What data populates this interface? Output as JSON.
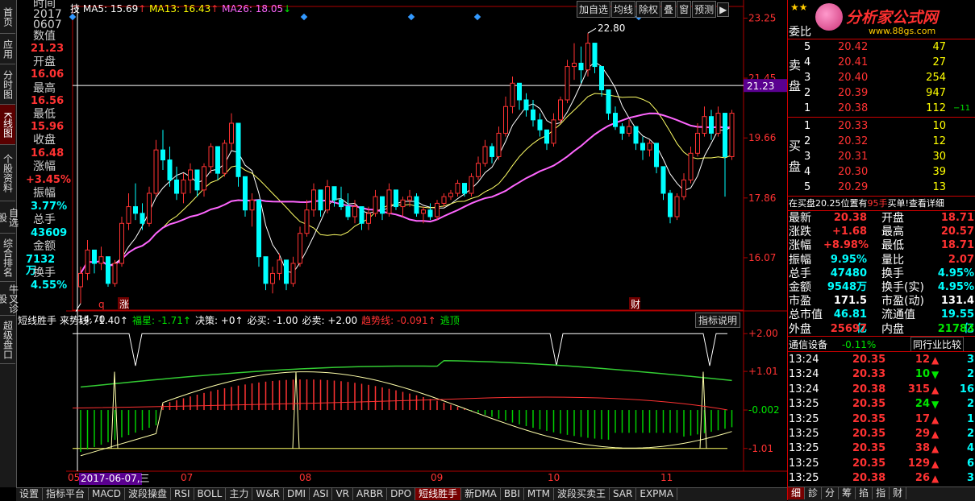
{
  "nav": [
    "首页",
    "应用",
    "分时图",
    "K线图",
    "个股资料",
    "自选股",
    "综合排名",
    "牛叉诊股",
    "超级盘口"
  ],
  "nav_active": 3,
  "info": {
    "time_label": "时间",
    "year": "2017",
    "date": "0607",
    "value_label": "数值",
    "value": "21.23",
    "open_label": "开盘",
    "open": "16.06",
    "high_label": "最高",
    "high": "16.56",
    "low_label": "最低",
    "low": "15.96",
    "close_label": "收盘",
    "close": "16.48",
    "chg_label": "涨幅",
    "chg": "+3.45%",
    "amp_label": "振幅",
    "amp": "3.77%",
    "vol_label": "总手",
    "vol": "43609",
    "amt_label": "金额",
    "amt": "7132万",
    "turn_label": "换手",
    "turn": "4.55%"
  },
  "ma_line": {
    "prefix": "技",
    "ma5": "MA5: 15.69",
    "ma13": "MA13: 16.43",
    "ma26": "MA26: 18.05"
  },
  "toolbar": [
    "加自选",
    "均线",
    "除权",
    "叠",
    "窗",
    "预测",
    "▶"
  ],
  "chart_data": {
    "type": "candlestick",
    "y_ticks": [
      "23.25",
      "21.45",
      "19.66",
      "17.86",
      "16.07"
    ],
    "y_ticks_values": [
      23.25,
      21.45,
      19.66,
      17.86,
      16.07
    ],
    "ylim": [
      14.5,
      23.6
    ],
    "crosshair_value": "21.23",
    "crosshair": 21.23,
    "max_label": "22.80",
    "min_label": "14.70",
    "x_labels": [
      "05",
      "07",
      "08",
      "09",
      "10",
      "11"
    ],
    "cursor_date": "2017-06-07,三",
    "markers": [
      "q",
      "涨",
      "财"
    ],
    "candles": [
      [
        15.2,
        15.8,
        14.7,
        15.6
      ],
      [
        15.6,
        16.6,
        15.4,
        16.3
      ],
      [
        16.3,
        16.2,
        15.6,
        15.9
      ],
      [
        15.9,
        16.4,
        15.7,
        16.1
      ],
      [
        16.1,
        15.5,
        15.2,
        15.3
      ],
      [
        15.3,
        16.0,
        15.2,
        15.9
      ],
      [
        15.9,
        17.3,
        15.8,
        17.1
      ],
      [
        17.1,
        18.0,
        16.9,
        17.6
      ],
      [
        17.6,
        18.3,
        17.2,
        17.4
      ],
      [
        17.4,
        17.7,
        16.9,
        17.1
      ],
      [
        17.1,
        18.2,
        17.0,
        18.0
      ],
      [
        18.0,
        19.6,
        17.9,
        19.3
      ],
      [
        19.3,
        19.9,
        18.7,
        19.0
      ],
      [
        19.0,
        19.4,
        18.2,
        18.4
      ],
      [
        18.4,
        18.8,
        17.8,
        18.0
      ],
      [
        18.0,
        18.6,
        17.7,
        18.4
      ],
      [
        18.4,
        18.9,
        18.0,
        18.7
      ],
      [
        18.7,
        18.6,
        17.9,
        18.1
      ],
      [
        18.1,
        18.9,
        17.9,
        18.8
      ],
      [
        18.8,
        19.5,
        18.6,
        19.4
      ],
      [
        19.4,
        19.3,
        18.4,
        18.6
      ],
      [
        18.6,
        19.6,
        18.5,
        19.5
      ],
      [
        19.5,
        20.4,
        19.3,
        20.1
      ],
      [
        20.1,
        19.8,
        18.2,
        18.5
      ],
      [
        18.5,
        18.2,
        17.3,
        17.5
      ],
      [
        17.5,
        18.0,
        17.0,
        17.8
      ],
      [
        17.8,
        17.6,
        15.8,
        16.1
      ],
      [
        16.1,
        15.9,
        15.1,
        15.3
      ],
      [
        15.3,
        15.8,
        15.0,
        15.6
      ],
      [
        15.6,
        16.2,
        15.4,
        16.0
      ],
      [
        16.0,
        15.8,
        15.1,
        15.3
      ],
      [
        15.3,
        16.1,
        15.2,
        15.9
      ],
      [
        15.9,
        17.0,
        15.8,
        16.8
      ],
      [
        16.8,
        17.8,
        16.7,
        17.5
      ],
      [
        17.5,
        18.3,
        17.3,
        18.1
      ],
      [
        18.1,
        18.0,
        17.3,
        17.5
      ],
      [
        17.5,
        18.4,
        17.4,
        18.2
      ],
      [
        18.2,
        18.1,
        17.6,
        17.8
      ],
      [
        17.8,
        18.2,
        17.5,
        17.6
      ],
      [
        17.6,
        18.0,
        17.2,
        17.3
      ],
      [
        17.3,
        17.8,
        17.1,
        17.6
      ],
      [
        17.6,
        17.5,
        16.9,
        17.1
      ],
      [
        17.1,
        17.6,
        16.9,
        17.4
      ],
      [
        17.4,
        18.1,
        17.3,
        17.9
      ],
      [
        17.9,
        17.8,
        17.2,
        17.4
      ],
      [
        17.4,
        18.3,
        17.3,
        18.1
      ],
      [
        18.1,
        18.0,
        17.5,
        17.6
      ],
      [
        17.6,
        17.9,
        17.3,
        17.8
      ],
      [
        17.8,
        18.1,
        17.6,
        17.9
      ],
      [
        17.9,
        18.0,
        17.3,
        17.4
      ],
      [
        17.4,
        17.6,
        17.1,
        17.5
      ],
      [
        17.5,
        17.7,
        17.2,
        17.3
      ],
      [
        17.3,
        17.8,
        17.2,
        17.7
      ],
      [
        17.7,
        18.0,
        17.6,
        17.9
      ],
      [
        17.9,
        18.1,
        17.8,
        18.0
      ],
      [
        18.0,
        18.4,
        17.9,
        18.3
      ],
      [
        18.3,
        18.2,
        17.9,
        18.0
      ],
      [
        18.0,
        18.6,
        17.9,
        18.5
      ],
      [
        18.5,
        19.1,
        18.4,
        18.9
      ],
      [
        18.9,
        19.6,
        18.8,
        19.4
      ],
      [
        19.4,
        19.5,
        18.9,
        19.1
      ],
      [
        19.1,
        20.0,
        19.0,
        19.8
      ],
      [
        19.8,
        20.9,
        19.7,
        20.6
      ],
      [
        20.6,
        21.5,
        20.4,
        21.3
      ],
      [
        21.3,
        21.2,
        20.5,
        20.8
      ],
      [
        20.8,
        21.0,
        20.3,
        20.5
      ],
      [
        20.5,
        20.8,
        20.0,
        20.2
      ],
      [
        20.2,
        20.4,
        19.7,
        19.9
      ],
      [
        19.9,
        19.7,
        19.3,
        19.5
      ],
      [
        19.5,
        20.4,
        19.4,
        20.2
      ],
      [
        20.2,
        20.9,
        20.1,
        20.8
      ],
      [
        20.8,
        22.0,
        20.7,
        21.8
      ],
      [
        21.8,
        22.5,
        21.4,
        21.9
      ],
      [
        21.9,
        22.4,
        21.3,
        21.7
      ],
      [
        21.7,
        22.8,
        21.5,
        22.5
      ],
      [
        22.5,
        22.1,
        21.6,
        21.8
      ],
      [
        21.8,
        21.7,
        20.9,
        21.1
      ],
      [
        21.1,
        21.0,
        20.2,
        20.4
      ],
      [
        20.4,
        20.6,
        19.9,
        20.0
      ],
      [
        20.0,
        20.1,
        19.6,
        19.8
      ],
      [
        19.8,
        20.2,
        19.7,
        20.0
      ],
      [
        20.0,
        19.9,
        19.3,
        19.5
      ],
      [
        19.5,
        19.7,
        19.0,
        19.3
      ],
      [
        19.3,
        19.6,
        19.1,
        19.5
      ],
      [
        19.5,
        19.4,
        18.6,
        18.8
      ],
      [
        18.8,
        18.6,
        17.8,
        18.0
      ],
      [
        18.0,
        18.1,
        17.1,
        17.3
      ],
      [
        17.3,
        18.0,
        17.2,
        17.9
      ],
      [
        17.9,
        18.6,
        17.8,
        18.4
      ],
      [
        18.4,
        19.4,
        18.3,
        19.2
      ],
      [
        19.2,
        20.1,
        19.1,
        19.8
      ],
      [
        19.8,
        20.6,
        19.7,
        20.3
      ],
      [
        20.3,
        20.5,
        19.6,
        19.8
      ],
      [
        19.8,
        20.6,
        19.7,
        20.4
      ],
      [
        20.4,
        20.3,
        17.9,
        19.1
      ],
      [
        19.1,
        20.5,
        19.0,
        20.4
      ]
    ]
  },
  "indicator": {
    "name": "短线胜手",
    "items": [
      {
        "text": "来势线: -1.40↑",
        "color": "#ffffff"
      },
      {
        "text": "福星: -1.71↑",
        "color": "#00e600"
      },
      {
        "text": "决策: +0↑",
        "color": "#ffffff"
      },
      {
        "text": "必买: -1.00",
        "color": "#ffffff"
      },
      {
        "text": "必卖: +2.00",
        "color": "#ffffff"
      },
      {
        "text": "趋势线: -0.091↑",
        "color": "#ff3232"
      },
      {
        "text": "逃顶",
        "color": "#00e600"
      }
    ],
    "help": "指标说明",
    "ticks": [
      "+2.00",
      "+1.01",
      "-0.002",
      "-1.01"
    ],
    "tick_values": [
      2.0,
      1.01,
      -0.002,
      -1.01
    ]
  },
  "bottom_tabs": [
    "设置",
    "指标平台",
    "MACD",
    "波段操盘",
    "RSI",
    "BOLL",
    "主力",
    "W&R",
    "DMI",
    "ASI",
    "VR",
    "ARBR",
    "DPO",
    "短线胜手",
    "新DMA",
    "BBI",
    "MTM",
    "波段买卖王",
    "SAR",
    "EXPMA"
  ],
  "bottom_active": 13,
  "right": {
    "logo_text": "分析家公式网",
    "logo_url": "www.88gs.com",
    "webi_label": "委比",
    "sell_label": "卖盘",
    "buy_label": "买盘",
    "sell": [
      {
        "n": "5",
        "p": "20.42",
        "v": "47"
      },
      {
        "n": "4",
        "p": "20.41",
        "v": "27"
      },
      {
        "n": "3",
        "p": "20.40",
        "v": "254"
      },
      {
        "n": "2",
        "p": "20.39",
        "v": "947"
      },
      {
        "n": "1",
        "p": "20.38",
        "v": "112",
        "d": "−11"
      }
    ],
    "buy": [
      {
        "n": "1",
        "p": "20.33",
        "v": "10"
      },
      {
        "n": "2",
        "p": "20.32",
        "v": "12"
      },
      {
        "n": "3",
        "p": "20.31",
        "v": "30"
      },
      {
        "n": "4",
        "p": "20.30",
        "v": "39"
      },
      {
        "n": "5",
        "p": "20.29",
        "v": "13"
      }
    ],
    "notice_a": "在买盘20.25位置有",
    "notice_b": "95手",
    "notice_c": "买单!查看详细",
    "stats": [
      [
        "最新",
        "20.38",
        "开盘",
        "18.71"
      ],
      [
        "涨跌",
        "+1.68",
        "最高",
        "20.57"
      ],
      [
        "涨幅",
        "+8.98%",
        "最低",
        "18.71"
      ],
      [
        "振幅",
        "9.95%",
        "量比",
        "2.07"
      ],
      [
        "总手",
        "47480",
        "换手",
        "4.95%"
      ],
      [
        "金额",
        "9548万",
        "换手(实)",
        "4.95%"
      ],
      [
        "市盈",
        "171.5",
        "市盈(动)",
        "131.4"
      ],
      [
        "总市值",
        "46.81亿",
        "流通值",
        "19.55亿"
      ],
      [
        "外盘",
        "25697",
        "内盘",
        "21783"
      ]
    ],
    "industry": "通信设备",
    "industry_chg": "-0.11%",
    "industry_btn": "同行业比较",
    "trades": [
      [
        "13:24",
        "20.35",
        "12",
        "up",
        "3"
      ],
      [
        "13:24",
        "20.33",
        "10",
        "down",
        "2"
      ],
      [
        "13:24",
        "20.38",
        "315",
        "up",
        "16"
      ],
      [
        "13:25",
        "20.35",
        "24",
        "down",
        "2"
      ],
      [
        "13:25",
        "20.35",
        "17",
        "up",
        "1"
      ],
      [
        "13:25",
        "20.35",
        "29",
        "up",
        "2"
      ],
      [
        "13:25",
        "20.35",
        "38",
        "up",
        "4"
      ],
      [
        "13:25",
        "20.35",
        "129",
        "up",
        "6"
      ],
      [
        "13:25",
        "20.38",
        "26",
        "up",
        "3"
      ]
    ],
    "tabs": [
      "细",
      "診",
      "分",
      "筹",
      "掐",
      "指",
      "财"
    ]
  }
}
